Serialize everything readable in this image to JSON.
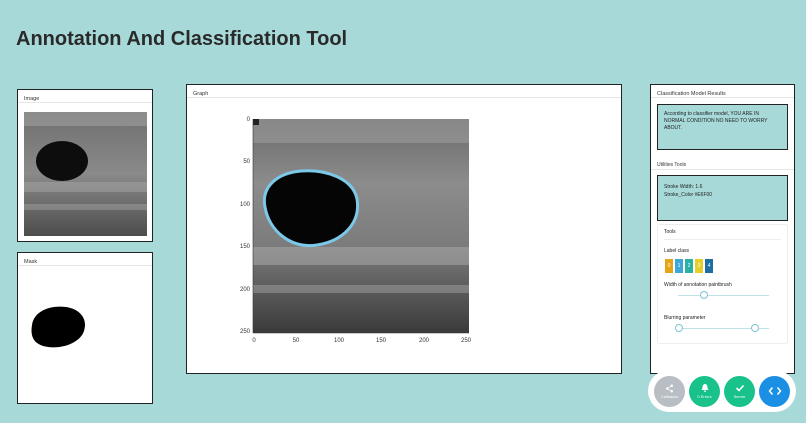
{
  "app": {
    "title": "Annotation And Classification Tool"
  },
  "image_card": {
    "header": "Image"
  },
  "mask_card": {
    "header": "Mask"
  },
  "graph_card": {
    "header": "Graph",
    "y_ticks": [
      "0",
      "50",
      "100",
      "150",
      "200",
      "250"
    ],
    "x_ticks": [
      "0",
      "50",
      "100",
      "150",
      "200",
      "250"
    ],
    "annotation_color": "#7cc8e8"
  },
  "results": {
    "header": "Classification Model Results",
    "text": "According to classifier model, YOU ARE IN NORMAL CONDITION NO NEED TO WORRY ABOUT."
  },
  "utilities": {
    "header": "Utilities Tools",
    "stroke_width": "Stroke Width: 1.6",
    "stroke_color": "Stroke_Color #E6F00"
  },
  "tools": {
    "title": "Tools",
    "label_class_label": "Label class",
    "classes": [
      {
        "label": "0",
        "color": "#e6a516"
      },
      {
        "label": "1",
        "color": "#3ea7d8"
      },
      {
        "label": "2",
        "color": "#2bb0a4"
      },
      {
        "label": "3",
        "color": "#e6cf2a"
      },
      {
        "label": "4",
        "color": "#1d6fa3"
      }
    ],
    "brush_width_label": "Width of annotation paintbrush",
    "brush_width_value": 0.27,
    "blur_label": "Blurring parameter",
    "blur_range": [
      0.0,
      0.83
    ]
  },
  "debug_bar": {
    "callbacks_label": "Callbacks",
    "errors_label": "0 Errors",
    "server_label": "Server"
  }
}
